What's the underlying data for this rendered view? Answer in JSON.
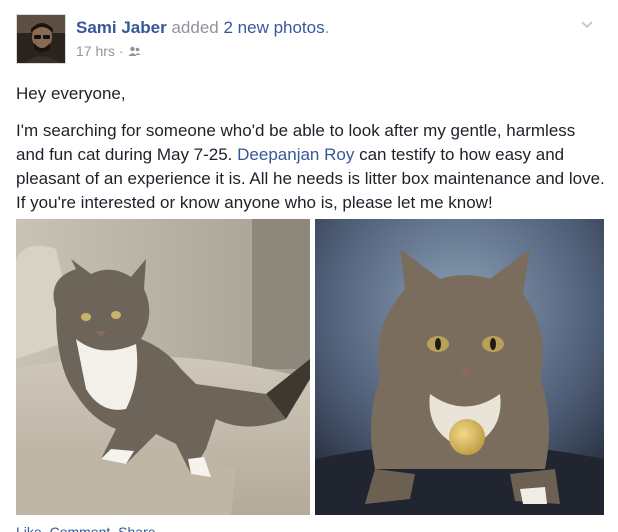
{
  "post": {
    "author": "Sami Jaber",
    "action": "added",
    "photos_link": "2 new photos",
    "period": ".",
    "timestamp": "17 hrs",
    "separator": "·",
    "audience_icon": "friends-icon",
    "menu_icon": "chevron-down-icon",
    "greeting": "Hey everyone,",
    "text_before_mention": "I'm searching for someone who'd be able to look after my gentle, harmless and fun cat during May 7-25. ",
    "mention": "Deepanjan Roy",
    "text_after_mention": " can testify to how easy and pleasant of an experience it is. All he needs is litter box maintenance and love. If you're interested or know anyone who is, please let me know!",
    "actions": [
      "Like",
      "Comment",
      "Share"
    ]
  },
  "colors": {
    "link": "#365899",
    "secondary_text": "#90949c",
    "body_text": "#1d2129"
  }
}
